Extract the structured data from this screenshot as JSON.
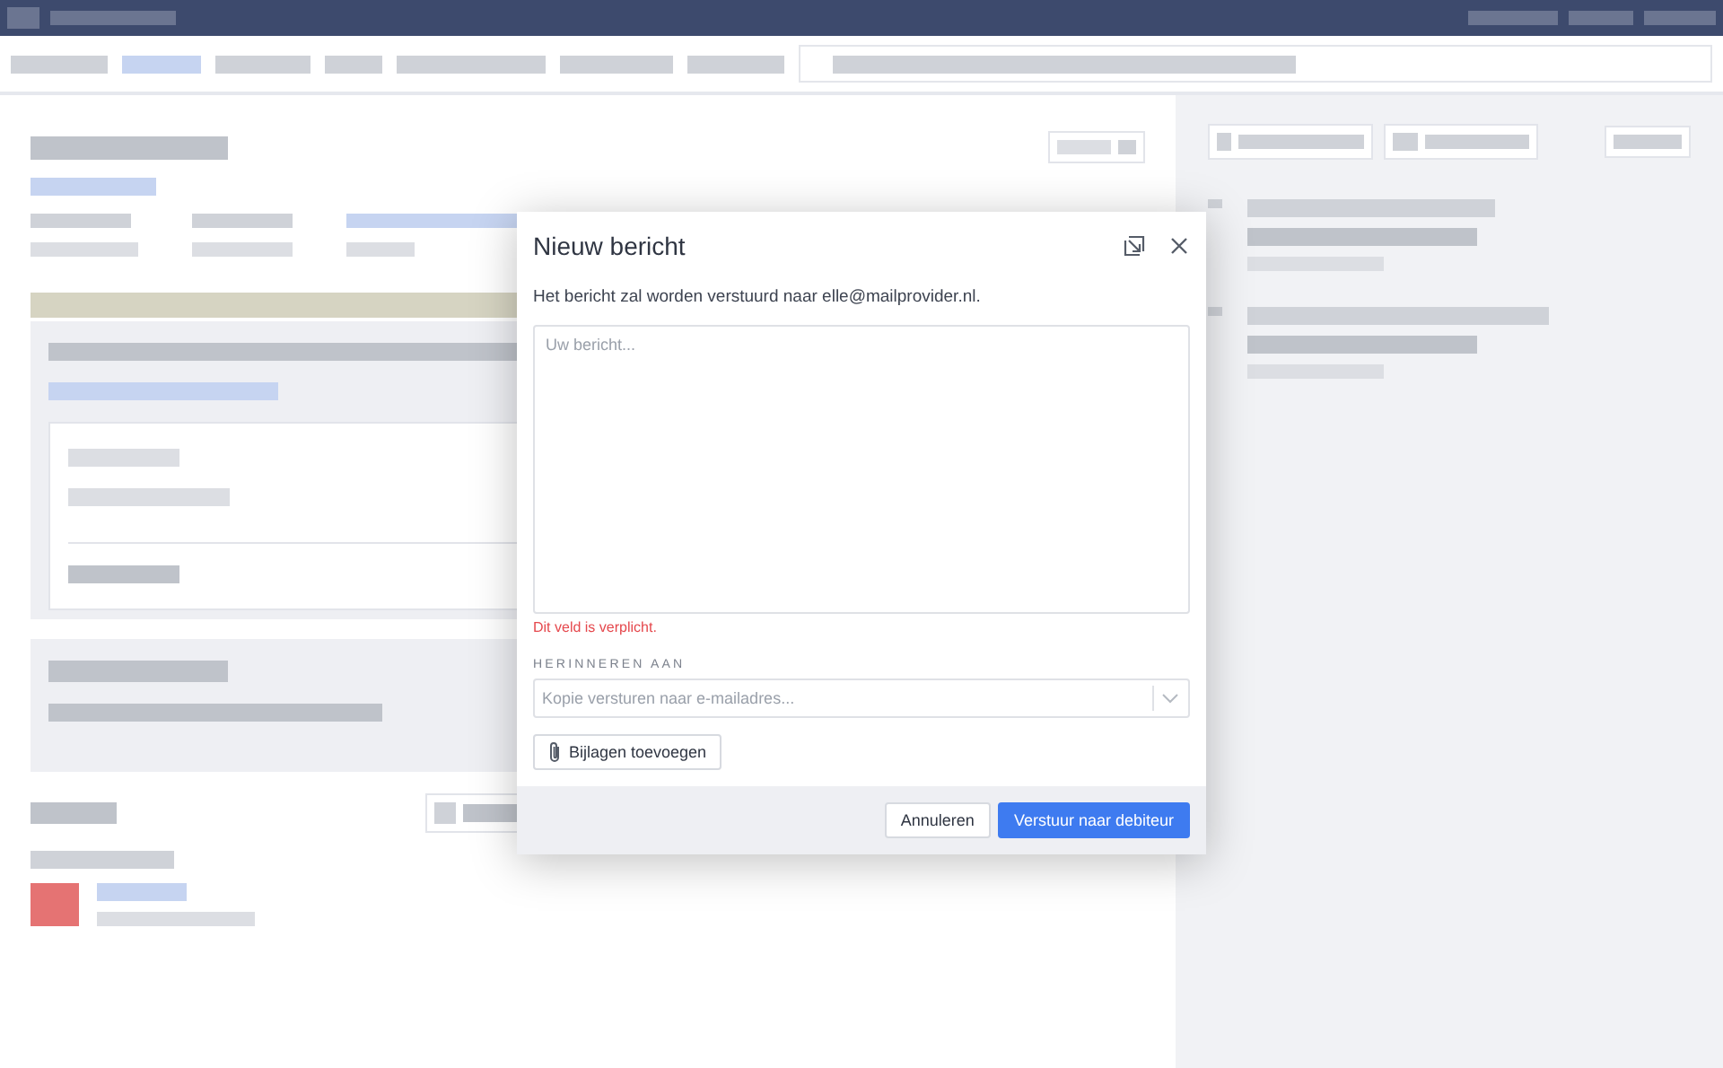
{
  "dialog": {
    "title": "Nieuw bericht",
    "info_text": "Het bericht zal worden verstuurd naar elle@mailprovider.nl.",
    "message_field": {
      "placeholder": "Uw bericht..."
    },
    "error": "Dit veld is verplicht.",
    "remind": {
      "label": "HERINNEREN AAN",
      "placeholder": "Kopie versturen naar e-mailadres..."
    },
    "attach_button": "Bijlagen toevoegen",
    "buttons": [
      {
        "kind": "secondary",
        "label": "Annuleren"
      },
      {
        "kind": "primary",
        "label": "Verstuur naar debiteur"
      }
    ]
  }
}
